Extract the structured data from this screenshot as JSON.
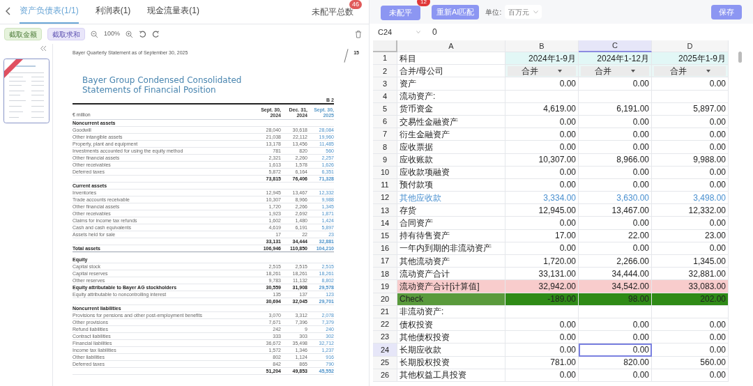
{
  "left_panel": {
    "tabs": [
      {
        "label": "资产负债表(1/1)",
        "selected": true
      },
      {
        "label": "利润表(1)",
        "selected": false
      },
      {
        "label": "现金流量表(1)",
        "selected": false
      }
    ],
    "unbalanced_total": {
      "label": "未配平总数",
      "badge": "46"
    },
    "toolbar": {
      "capture_amount": "截取金额",
      "capture_sum": "截取求和",
      "zoom": "100%"
    },
    "document": {
      "header_line": "Bayer Quarterly Statement as of September 30, 2025",
      "page_number": "15",
      "title": "Bayer Group Condensed Consolidated Statements of Financial Position",
      "table_ref": "B 2",
      "unit": "€ million",
      "columns": [
        [
          "Sept. 30,",
          "2024"
        ],
        [
          "Dec. 31,",
          "2024"
        ],
        [
          "Sept. 30,",
          "2025"
        ]
      ],
      "rows": [
        {
          "kind": "header",
          "label": "Noncurrent assets"
        },
        {
          "kind": "item",
          "label": "Goodwill",
          "values": [
            "28,040",
            "30,618",
            "28,084"
          ]
        },
        {
          "kind": "item",
          "label": "Other intangible assets",
          "values": [
            "21,038",
            "22,112",
            "19,960"
          ]
        },
        {
          "kind": "item",
          "label": "Property, plant and equipment",
          "values": [
            "13,178",
            "13,456",
            "11,485"
          ]
        },
        {
          "kind": "item",
          "label": "Investments accounted for using the equity method",
          "values": [
            "781",
            "820",
            "560"
          ]
        },
        {
          "kind": "item",
          "label": "Other financial assets",
          "values": [
            "2,321",
            "2,260",
            "2,257"
          ]
        },
        {
          "kind": "item",
          "label": "Other receivables",
          "values": [
            "1,613",
            "1,578",
            "1,626"
          ]
        },
        {
          "kind": "item",
          "label": "Deferred taxes",
          "values": [
            "5,872",
            "6,164",
            "6,351"
          ]
        },
        {
          "kind": "subtotal",
          "values": [
            "73,815",
            "76,406",
            "71,328"
          ]
        },
        {
          "kind": "header",
          "label": "Current assets"
        },
        {
          "kind": "item",
          "label": "Inventories",
          "values": [
            "12,945",
            "13,467",
            "12,332"
          ]
        },
        {
          "kind": "item",
          "label": "Trade accounts receivable",
          "values": [
            "10,307",
            "8,966",
            "9,988"
          ]
        },
        {
          "kind": "item",
          "label": "Other financial assets",
          "values": [
            "1,720",
            "2,266",
            "1,345"
          ]
        },
        {
          "kind": "item",
          "label": "Other receivables",
          "values": [
            "1,923",
            "2,692",
            "1,871"
          ]
        },
        {
          "kind": "item",
          "label": "Claims for income tax refunds",
          "values": [
            "1,602",
            "1,480",
            "1,424"
          ]
        },
        {
          "kind": "item",
          "label": "Cash and cash equivalents",
          "values": [
            "4,619",
            "6,191",
            "5,897"
          ]
        },
        {
          "kind": "item",
          "label": "Assets held for sale",
          "values": [
            "17",
            "22",
            "23"
          ]
        },
        {
          "kind": "subtotal",
          "values": [
            "33,131",
            "34,444",
            "32,881"
          ]
        },
        {
          "kind": "total",
          "label": "Total assets",
          "values": [
            "106,946",
            "110,850",
            "104,210"
          ]
        },
        {
          "kind": "header",
          "label": "Equity"
        },
        {
          "kind": "item",
          "label": "Capital stock",
          "values": [
            "2,515",
            "2,515",
            "2,515"
          ]
        },
        {
          "kind": "item",
          "label": "Capital reserves",
          "values": [
            "18,261",
            "18,261",
            "18,261"
          ]
        },
        {
          "kind": "item",
          "label": "Other reserves",
          "values": [
            "9,783",
            "11,132",
            "8,802"
          ]
        },
        {
          "kind": "bold",
          "label": "Equity attributable to Bayer AG stockholders",
          "values": [
            "30,559",
            "31,908",
            "29,578"
          ]
        },
        {
          "kind": "item",
          "label": "Equity attributable to noncontrolling interest",
          "values": [
            "135",
            "137",
            "123"
          ]
        },
        {
          "kind": "subtotal",
          "values": [
            "30,694",
            "32,045",
            "29,701"
          ]
        },
        {
          "kind": "header",
          "label": "Noncurrent liabilities"
        },
        {
          "kind": "item",
          "label": "Provisions for pensions and other post-employment benefits",
          "values": [
            "3,070",
            "3,312",
            "2,078"
          ]
        },
        {
          "kind": "item",
          "label": "Other provisions",
          "values": [
            "7,671",
            "7,396",
            "7,379"
          ]
        },
        {
          "kind": "item",
          "label": "Refund liabilities",
          "values": [
            "242",
            "9",
            "240"
          ]
        },
        {
          "kind": "item",
          "label": "Contract liabilities",
          "values": [
            "333",
            "303",
            "302"
          ]
        },
        {
          "kind": "item",
          "label": "Financial liabilities",
          "values": [
            "36,672",
            "35,498",
            "32,712"
          ]
        },
        {
          "kind": "item",
          "label": "Income tax liabilities",
          "values": [
            "1,572",
            "1,346",
            "1,237"
          ]
        },
        {
          "kind": "item",
          "label": "Other liabilities",
          "values": [
            "802",
            "1,124",
            "916"
          ]
        },
        {
          "kind": "item",
          "label": "Deferred taxes",
          "values": [
            "842",
            "865",
            "790"
          ]
        },
        {
          "kind": "subtotal",
          "values": [
            "51,204",
            "49,853",
            "45,552"
          ]
        }
      ]
    }
  },
  "right_panel": {
    "toolbar": {
      "unbalanced_button": "未配平",
      "unbalanced_badge": "12",
      "rematch_button": "重新AI匹配",
      "unit_label": "单位:",
      "unit_value": "百万元",
      "save_button": "保存"
    },
    "formula_bar": {
      "cell": "C24",
      "value": "0"
    },
    "columns": [
      {
        "label": "A",
        "selected": false
      },
      {
        "label": "B",
        "selected": false
      },
      {
        "label": "C",
        "selected": true
      },
      {
        "label": "D",
        "selected": false
      }
    ],
    "rows": [
      {
        "n": "1",
        "kind": "header",
        "selected": false,
        "cells": [
          "科目",
          "2024年1-9月",
          "2024年1-12月",
          "2025年1-9月"
        ]
      },
      {
        "n": "2",
        "kind": "dropdown",
        "selected": false,
        "cells": [
          "合并/母公司",
          "合并",
          "合并",
          "合并"
        ]
      },
      {
        "n": "3",
        "kind": "normal",
        "selected": false,
        "cells": [
          "资产",
          "0.00",
          "0.00",
          "0.00"
        ]
      },
      {
        "n": "4",
        "kind": "normal",
        "selected": false,
        "cells": [
          "流动资产:"
        ]
      },
      {
        "n": "5",
        "kind": "normal",
        "selected": false,
        "cells": [
          "货币资金",
          "4,619.00",
          "6,191.00",
          "5,897.00"
        ]
      },
      {
        "n": "6",
        "kind": "normal",
        "selected": false,
        "cells": [
          "交易性金融资产",
          "0.00",
          "0.00",
          "0.00"
        ]
      },
      {
        "n": "7",
        "kind": "normal",
        "selected": false,
        "cells": [
          "衍生金融资产",
          "0.00",
          "0.00",
          "0.00"
        ]
      },
      {
        "n": "8",
        "kind": "normal",
        "selected": false,
        "cells": [
          "应收票据",
          "0.00",
          "0.00",
          "0.00"
        ]
      },
      {
        "n": "9",
        "kind": "normal",
        "selected": false,
        "cells": [
          "应收账款",
          "10,307.00",
          "8,966.00",
          "9,988.00"
        ]
      },
      {
        "n": "10",
        "kind": "normal",
        "selected": false,
        "cells": [
          "应收款项融资",
          "0.00",
          "0.00",
          "0.00"
        ]
      },
      {
        "n": "11",
        "kind": "normal",
        "selected": false,
        "cells": [
          "预付款项",
          "0.00",
          "0.00",
          "0.00"
        ]
      },
      {
        "n": "12",
        "kind": "linked",
        "selected": false,
        "cells": [
          "其他应收款",
          "3,334.00",
          "3,630.00",
          "3,498.00"
        ]
      },
      {
        "n": "13",
        "kind": "normal",
        "selected": false,
        "cells": [
          "存货",
          "12,945.00",
          "13,467.00",
          "12,332.00"
        ]
      },
      {
        "n": "14",
        "kind": "normal",
        "selected": false,
        "cells": [
          "合同资产",
          "0.00",
          "0.00",
          "0.00"
        ]
      },
      {
        "n": "15",
        "kind": "normal",
        "selected": false,
        "cells": [
          "持有待售资产",
          "17.00",
          "22.00",
          "23.00"
        ]
      },
      {
        "n": "16",
        "kind": "normal",
        "selected": false,
        "cells": [
          "一年内到期的非流动资产",
          "0.00",
          "0.00",
          "0.00"
        ]
      },
      {
        "n": "17",
        "kind": "normal",
        "selected": false,
        "cells": [
          "其他流动资产",
          "1,720.00",
          "2,266.00",
          "1,345.00"
        ]
      },
      {
        "n": "18",
        "kind": "normal",
        "selected": false,
        "cells": [
          "流动资产合计",
          "33,131.00",
          "34,444.00",
          "32,881.00"
        ]
      },
      {
        "n": "19",
        "kind": "computed",
        "selected": false,
        "cells": [
          "流动资产合计[计算值]",
          "32,942.00",
          "34,542.00",
          "33,083.00"
        ]
      },
      {
        "n": "20",
        "kind": "check",
        "selected": false,
        "cells": [
          "Check",
          "-189.00",
          "98.00",
          "202.00"
        ]
      },
      {
        "n": "21",
        "kind": "normal",
        "selected": false,
        "cells": [
          "非流动资产:"
        ]
      },
      {
        "n": "22",
        "kind": "normal",
        "selected": false,
        "cells": [
          "债权投资",
          "0.00",
          "0.00",
          "0.00"
        ]
      },
      {
        "n": "23",
        "kind": "normal",
        "selected": false,
        "cells": [
          "其他债权投资",
          "0.00",
          "0.00",
          "0.00"
        ]
      },
      {
        "n": "24",
        "kind": "normal",
        "selected": true,
        "cells": [
          "长期应收款",
          "0.00",
          "0.00",
          "0.00"
        ]
      },
      {
        "n": "25",
        "kind": "normal",
        "selected": false,
        "cells": [
          "长期股权投资",
          "781.00",
          "820.00",
          "560.00"
        ]
      },
      {
        "n": "26",
        "kind": "normal",
        "selected": false,
        "cells": [
          "其他权益工具投资",
          "0.00",
          "0.00",
          "0.00"
        ]
      }
    ]
  }
}
